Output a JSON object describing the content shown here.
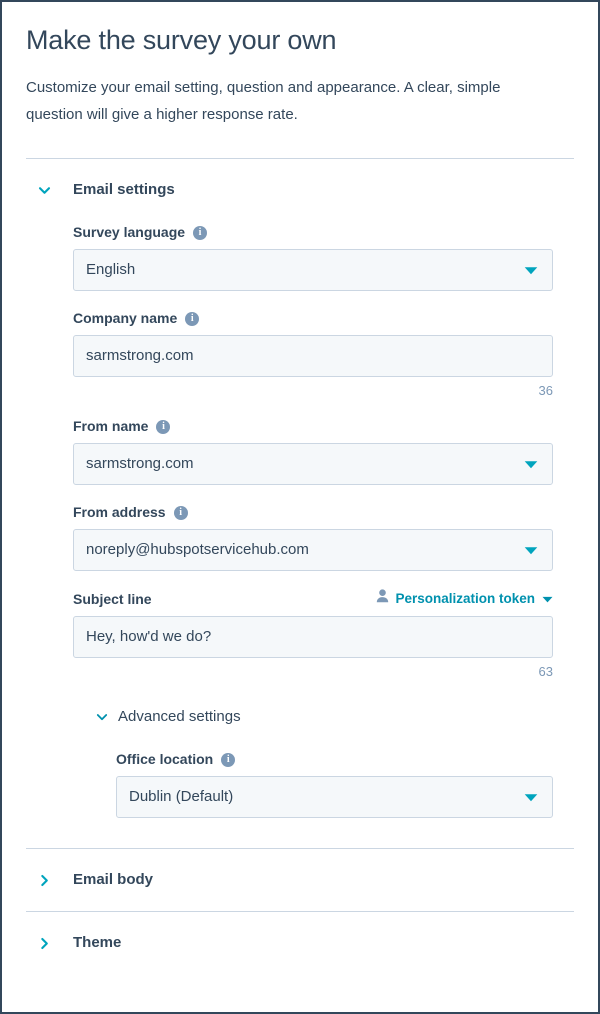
{
  "page": {
    "title": "Make the survey your own",
    "description": "Customize your email setting, question and appearance. A clear, simple question will give a higher response rate."
  },
  "colors": {
    "accent_teal": "#00a4bd",
    "link_teal": "#0091ae",
    "text_dark": "#33475b",
    "muted_blue": "#7c98b6",
    "border": "#cbd6e2",
    "field_bg": "#f5f8fa"
  },
  "sections": {
    "email_settings": {
      "title": "Email settings",
      "expanded": true,
      "chevron_icon": "chevron-down-icon",
      "fields": {
        "survey_language": {
          "label": "Survey language",
          "info_icon": "info-icon",
          "value": "English",
          "type": "select",
          "caret_icon": "caret-down-icon"
        },
        "company_name": {
          "label": "Company name",
          "info_icon": "info-icon",
          "value": "sarmstrong.com",
          "type": "text",
          "counter": "36"
        },
        "from_name": {
          "label": "From name",
          "info_icon": "info-icon",
          "value": "sarmstrong.com",
          "type": "select",
          "caret_icon": "caret-down-icon"
        },
        "from_address": {
          "label": "From address",
          "info_icon": "info-icon",
          "value": "noreply@hubspotservicehub.com",
          "type": "select",
          "caret_icon": "caret-down-icon"
        },
        "subject_line": {
          "label": "Subject line",
          "value": "Hey, how'd we do?",
          "type": "text",
          "counter": "63",
          "token_link": {
            "label": "Personalization token",
            "icon": "person-icon",
            "caret_icon": "caret-down-icon"
          }
        }
      },
      "advanced": {
        "title": "Advanced settings",
        "expanded": true,
        "chevron_icon": "chevron-down-icon",
        "office_location": {
          "label": "Office location",
          "info_icon": "info-icon",
          "value": "Dublin (Default)",
          "type": "select",
          "caret_icon": "caret-down-icon"
        }
      }
    },
    "email_body": {
      "title": "Email body",
      "expanded": false,
      "chevron_icon": "chevron-right-icon"
    },
    "theme": {
      "title": "Theme",
      "expanded": false,
      "chevron_icon": "chevron-right-icon"
    }
  },
  "info_glyph": "i"
}
